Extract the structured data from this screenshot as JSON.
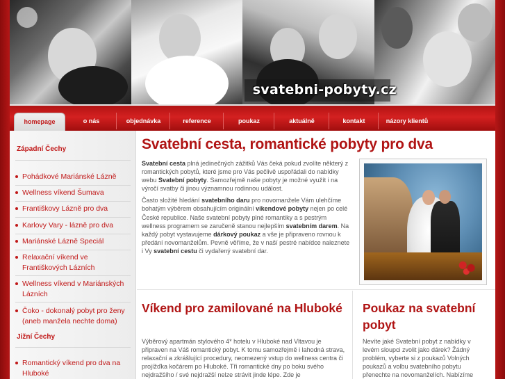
{
  "header": {
    "site_title": "svatebni-pobyty.cz"
  },
  "nav": {
    "items": [
      {
        "label": "homepage",
        "active": true
      },
      {
        "label": "o nás"
      },
      {
        "label": "objednávka"
      },
      {
        "label": "reference"
      },
      {
        "label": "poukaz"
      },
      {
        "label": "aktuálně"
      },
      {
        "label": "kontakt"
      },
      {
        "label": "názory klientů"
      }
    ]
  },
  "sidebar": {
    "heading_west": "Západní Čechy",
    "items_west": [
      "Pohádkové Mariánské Lázně",
      "Wellness víkend Šumava",
      "Františkovy Lázně pro dva",
      "Karlovy Vary - lázně pro dva",
      "Mariánské Lázně Speciál",
      "Relaxační víkend ve Františkových Lázních",
      "Wellness víkend v Mariánských Lázních",
      "Čoko - dokonalý pobyt pro ženy (aneb manžela nechte doma)"
    ],
    "heading_south": "Jižní Čechy",
    "items_south": [
      "Romantický víkend pro dva na Hluboké"
    ]
  },
  "main": {
    "title": "Svatební cesta, romantické pobyty pro dva",
    "intro_p1_a": "Svatební cesta",
    "intro_p1_b": " plná jedinečných zážitků Vás čeká pokud zvolíte některý z romantických pobytů, které jsme pro Vás pečlivě uspořádali do nabídky webu ",
    "intro_p1_c": "Svatební pobyty",
    "intro_p1_d": ". Samozřejmě naše pobyty je možné využít i na výročí svatby či jinou významnou rodinnou událost.",
    "intro_p2_a": "Často složité hledání ",
    "intro_p2_b": "svatebního daru",
    "intro_p2_c": " pro novomanžele Vám ulehčíme bohatým výběrem obsahujícím originální ",
    "intro_p2_d": "víkendové pobyty",
    "intro_p2_e": " nejen po celé České republice. Naše svatební pobyty plné romantiky a s pestrým wellness programem se zaručeně stanou nejlepším ",
    "intro_p2_f": "svatebním darem",
    "intro_p2_g": ". Na každý pobyt vystavujeme ",
    "intro_p2_h": "dárkový poukaz",
    "intro_p2_i": " a vše je připraveno rovnou k předání novomanželům. Pevně věříme, že v naší pestré nabídce naleznete i Vy ",
    "intro_p2_j": "svatební cestu",
    "intro_p2_k": " či vydařený svatební dar.",
    "left_col": {
      "title": "Víkend pro zamilované na Hluboké",
      "text": "Výběrový apartmán stylového 4* hotelu v Hluboké nad Vltavou je připraven na Váš romantický pobyt. K tomu samozřejmě i lahodná strava, relaxační a zkrášlující procedury, neomezený vstup do wellness centra či projížďka kočárem po Hluboké. Tři romantické dny po boku svého nejdražšího / své nejdražší nelze strávit jinde lépe. Zde je"
    },
    "right_col": {
      "title": "Poukaz na svatební pobyt",
      "text": "Nevíte jaké Svatební pobyt z nabídky v levém sloupci zvolit jako dárek? Žádný problém, vyberte si z poukazů Volných poukazů a volbu svatebního pobytu přenechte na novomanželích. Nabízíme"
    }
  }
}
